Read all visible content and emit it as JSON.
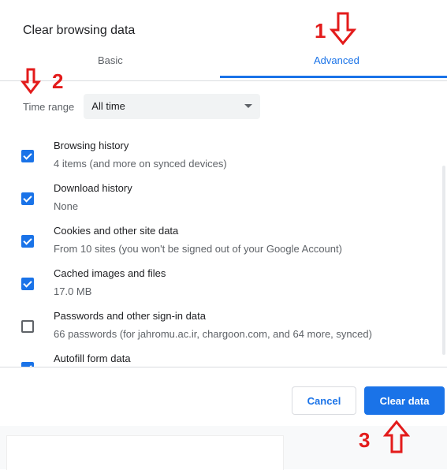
{
  "dialog": {
    "title": "Clear browsing data",
    "tabs": [
      {
        "label": "Basic",
        "active": false
      },
      {
        "label": "Advanced",
        "active": true
      }
    ],
    "time_range": {
      "label": "Time range",
      "value": "All time"
    },
    "items": [
      {
        "title": "Browsing history",
        "subtitle": "4 items (and more on synced devices)",
        "checked": true
      },
      {
        "title": "Download history",
        "subtitle": "None",
        "checked": true
      },
      {
        "title": "Cookies and other site data",
        "subtitle": "From 10 sites (you won't be signed out of your Google Account)",
        "checked": true
      },
      {
        "title": "Cached images and files",
        "subtitle": "17.0 MB",
        "checked": true
      },
      {
        "title": "Passwords and other sign-in data",
        "subtitle": "66 passwords (for jahromu.ac.ir, chargoon.com, and 64 more, synced)",
        "checked": false
      },
      {
        "title": "Autofill form data",
        "subtitle": "",
        "checked": true
      }
    ],
    "buttons": {
      "cancel": "Cancel",
      "clear": "Clear data"
    }
  },
  "annotations": {
    "step1": "1",
    "step2": "2",
    "step3": "3",
    "color": "#e31b1b"
  },
  "colors": {
    "accent": "#1a73e8",
    "text": "#202124",
    "secondary": "#5f6368"
  }
}
